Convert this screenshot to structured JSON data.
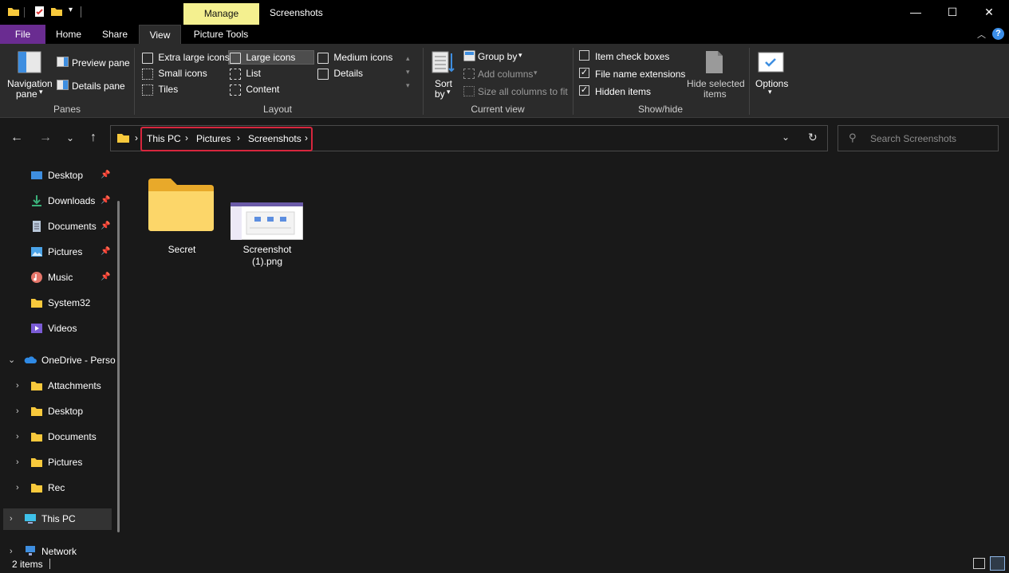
{
  "window": {
    "title": "Screenshots",
    "manage_tab": "Manage",
    "minimize": "—",
    "maximize": "☐",
    "close": "✕"
  },
  "tabs": {
    "file": "File",
    "home": "Home",
    "share": "Share",
    "view": "View",
    "picture_tools": "Picture Tools"
  },
  "ribbon": {
    "panes": {
      "label": "Panes",
      "navigation_pane_1": "Navigation",
      "navigation_pane_2": "pane",
      "preview_pane": "Preview pane",
      "details_pane": "Details pane"
    },
    "layout": {
      "label": "Layout",
      "items": [
        "Extra large icons",
        "Large icons",
        "Medium icons",
        "Small icons",
        "List",
        "Details",
        "Tiles",
        "Content"
      ],
      "selected": "Large icons"
    },
    "current_view": {
      "label": "Current view",
      "sort_1": "Sort",
      "sort_2": "by",
      "group_by": "Group by",
      "add_columns": "Add columns",
      "size_columns": "Size all columns to fit"
    },
    "show_hide": {
      "label": "Show/hide",
      "item_check_boxes": "Item check boxes",
      "file_name_extensions": "File name extensions",
      "hidden_items": "Hidden items",
      "hide_selected_1": "Hide selected",
      "hide_selected_2": "items",
      "item_check_boxes_checked": false,
      "file_name_extensions_checked": true,
      "hidden_items_checked": true
    },
    "options": "Options"
  },
  "address": {
    "crumbs": [
      "This PC",
      "Pictures",
      "Screenshots"
    ],
    "search_placeholder": "Search Screenshots"
  },
  "nav": {
    "quick_access": [
      "Desktop",
      "Downloads",
      "Documents",
      "Pictures",
      "Music",
      "System32",
      "Videos"
    ],
    "onedrive": "OneDrive - Perso",
    "onedrive_children": [
      "Attachments",
      "Desktop",
      "Documents",
      "Pictures",
      "Rec"
    ],
    "this_pc": "This PC",
    "network": "Network"
  },
  "content": {
    "items": [
      {
        "name": "Secret",
        "type": "folder"
      },
      {
        "name_1": "Screenshot",
        "name_2": "(1).png",
        "type": "image"
      }
    ]
  },
  "status": {
    "count": "2 items"
  },
  "colors": {
    "accent_file_tab": "#6a2c91",
    "manage_tab": "#f4f08f",
    "highlight_box": "#d7263d",
    "folder_yellow": "#f8c93c"
  }
}
